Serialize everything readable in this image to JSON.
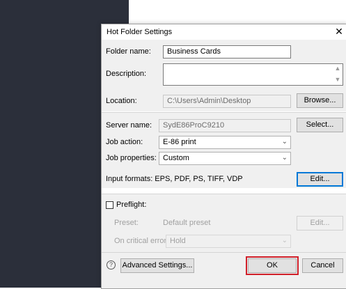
{
  "dialog": {
    "title": "Hot Folder Settings",
    "close_glyph": "✕"
  },
  "fields": {
    "folder_name_label": "Folder name:",
    "folder_name_value": "Business Cards",
    "description_label": "Description:",
    "description_value": "",
    "location_label": "Location:",
    "location_value": "C:\\Users\\Admin\\Desktop",
    "browse_button": "Browse...",
    "server_name_label": "Server name:",
    "server_name_value": "SydE86ProC9210",
    "select_button": "Select...",
    "job_action_label": "Job action:",
    "job_action_value": "E-86 print",
    "job_properties_label": "Job properties:",
    "job_properties_value": "Custom",
    "input_formats_text": "Input formats: EPS, PDF, PS, TIFF, VDP",
    "edit_button": "Edit..."
  },
  "preflight": {
    "checkbox_label": "Preflight:",
    "checked": false,
    "preset_label": "Preset:",
    "preset_value": "Default preset",
    "preset_edit_button": "Edit...",
    "critical_error_label": "On critical error:",
    "critical_error_value": "Hold"
  },
  "footer": {
    "help_glyph": "?",
    "advanced_button": "Advanced Settings...",
    "ok_button": "OK",
    "cancel_button": "Cancel"
  },
  "colors": {
    "highlight": "#d0202a",
    "focus": "#0078d7",
    "background_dark": "#2b2f3a"
  }
}
